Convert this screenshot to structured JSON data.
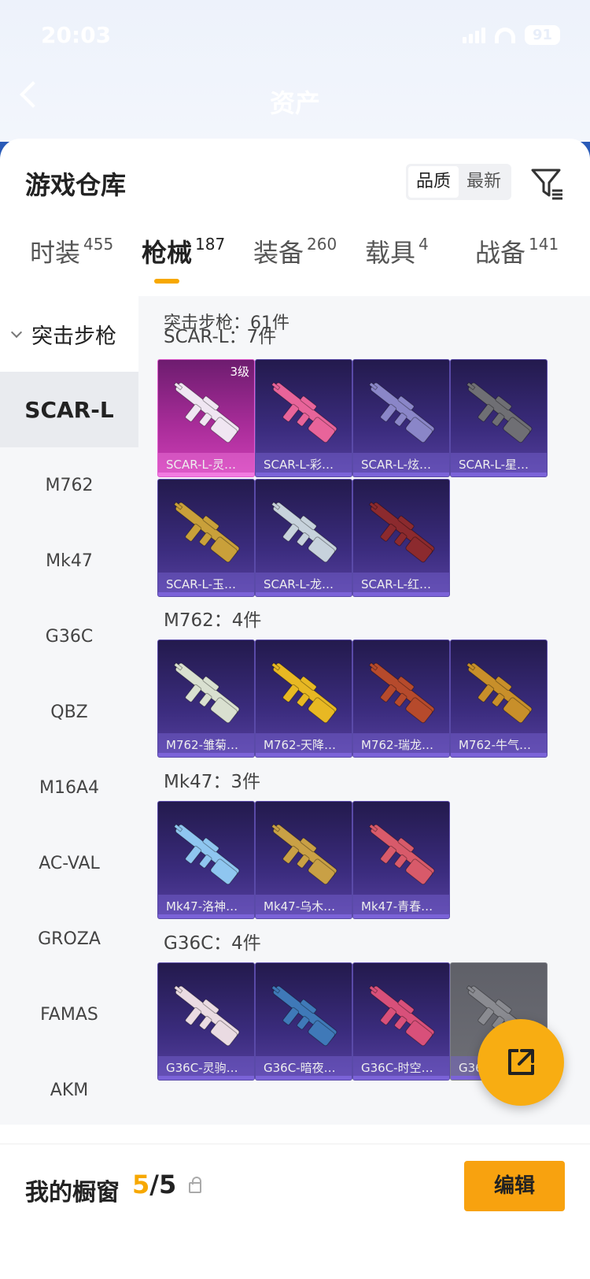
{
  "status_bar": {
    "time": "20:03",
    "battery": "91"
  },
  "nav": {
    "title": "资产"
  },
  "sheet": {
    "title": "游戏仓库",
    "sort_options": [
      "品质",
      "最新"
    ],
    "sort_selected": "品质"
  },
  "tabs": [
    {
      "label": "时装",
      "count": "455"
    },
    {
      "label": "枪械",
      "count": "187",
      "active": true
    },
    {
      "label": "装备",
      "count": "260"
    },
    {
      "label": "载具",
      "count": "4"
    },
    {
      "label": "战备",
      "count": "141"
    }
  ],
  "sidebar": {
    "header": "突击步枪",
    "items": [
      "SCAR-L",
      "M762",
      "Mk47",
      "G36C",
      "QBZ",
      "M16A4",
      "AC-VAL",
      "GROZA",
      "FAMAS",
      "AKM"
    ],
    "active": "SCAR-L"
  },
  "content": {
    "total": "突击步枪：61件",
    "groups": [
      {
        "title": "SCAR-L：7件",
        "items": [
          {
            "name": "SCAR-L-灵…",
            "tier": "3级",
            "style": "gold",
            "gun_color": "#f0e6f2"
          },
          {
            "name": "SCAR-L-彩…",
            "style": "purple",
            "gun_color": "#e8649a"
          },
          {
            "name": "SCAR-L-炫…",
            "style": "purple",
            "gun_color": "#8a86c8"
          },
          {
            "name": "SCAR-L-星…",
            "style": "purple",
            "gun_color": "#6f6f74"
          },
          {
            "name": "SCAR-L-玉…",
            "style": "purple",
            "gun_color": "#c9a03a"
          },
          {
            "name": "SCAR-L-龙…",
            "style": "purple",
            "gun_color": "#c7d2dc"
          },
          {
            "name": "SCAR-L-红…",
            "style": "purple",
            "gun_color": "#8c2a2e"
          }
        ]
      },
      {
        "title": "M762：4件",
        "items": [
          {
            "name": "M762-雏菊…",
            "style": "purple",
            "gun_color": "#d9e0d0"
          },
          {
            "name": "M762-天降…",
            "style": "purple",
            "gun_color": "#e8b823"
          },
          {
            "name": "M762-瑞龙…",
            "style": "purple",
            "gun_color": "#b64a2c"
          },
          {
            "name": "M762-牛气…",
            "style": "purple",
            "gun_color": "#c88f2a"
          }
        ]
      },
      {
        "title": "Mk47：3件",
        "items": [
          {
            "name": "Mk47-洛神…",
            "style": "purple",
            "gun_color": "#8fc6f0"
          },
          {
            "name": "Mk47-乌木…",
            "style": "purple",
            "gun_color": "#c9a045"
          },
          {
            "name": "Mk47-青春…",
            "style": "purple",
            "gun_color": "#d85a6a"
          }
        ]
      },
      {
        "title": "G36C：4件",
        "items": [
          {
            "name": "G36C-灵驹…",
            "style": "purple",
            "gun_color": "#eadbe2"
          },
          {
            "name": "G36C-暗夜…",
            "style": "purple",
            "gun_color": "#3f79b8"
          },
          {
            "name": "G36C-时空…",
            "style": "purple",
            "gun_color": "#d8507a"
          },
          {
            "name": "G36C-乌木…",
            "style": "grey",
            "gun_color": "#8a8b91"
          }
        ]
      }
    ]
  },
  "showcase": {
    "title": "我的橱窗",
    "used": "5",
    "separator": "/",
    "total": "5",
    "edit_label": "编辑"
  },
  "colors": {
    "accent": "#f7a800",
    "header_bg": "#2a5bb8"
  },
  "icons": {
    "back": "chevron-left-icon",
    "filter": "filter-icon",
    "share": "share-out-icon",
    "lock": "lock-icon"
  }
}
